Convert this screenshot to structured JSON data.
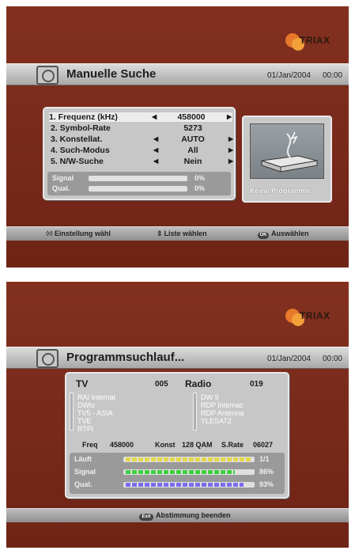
{
  "screen1": {
    "brand": "TRIAX",
    "title": "Manuelle Suche",
    "date": "01/Jan/2004",
    "time": "00:00",
    "fields": [
      {
        "label": "1. Frequenz (kHz)",
        "value": "458000",
        "arrows": true
      },
      {
        "label": "2. Symbol-Rate",
        "value": "5273",
        "arrows": false
      },
      {
        "label": "3. Konstellat.",
        "value": "AUTO",
        "arrows": true
      },
      {
        "label": "4. Such-Modus",
        "value": "All",
        "arrows": true
      },
      {
        "label": "5. N/W-Suche",
        "value": "Nein",
        "arrows": true
      }
    ],
    "signal_label": "Signal",
    "signal_pct": "0%",
    "quality_label": "Qual.",
    "quality_pct": "0%",
    "preview_caption": "Keine Programme",
    "hints": {
      "setting": "Einstellung wähl",
      "list": "Liste wählen",
      "ok_icon": "OK",
      "select": "Auswählen"
    }
  },
  "screen2": {
    "brand": "TRIAX",
    "title": "Programmsuchlauf...",
    "date": "01/Jan/2004",
    "time": "00:00",
    "tv_label": "TV",
    "tv_count": "005",
    "radio_label": "Radio",
    "radio_count": "019",
    "tv_channels": [
      "RAI Internat",
      "DWtv",
      "TV5 - ASIA",
      "TVE",
      "RTPi"
    ],
    "radio_channels": [
      "DW 9",
      "RDP Internac",
      "RDP Antenna",
      "YLESAT2"
    ],
    "freq_label": "Freq",
    "freq_value": "458000",
    "konst_label": "Konst",
    "konst_value": "128 QAM",
    "srate_label": "S.Rate",
    "srate_value": "06027",
    "progress_label": "Läuft",
    "progress_value": "1/1",
    "signal_label": "Signal",
    "signal_pct": "86%",
    "quality_label": "Qual.",
    "quality_pct": "93%",
    "meters": {
      "progress": 1.0,
      "signal": 0.86,
      "quality": 0.93
    },
    "colors": {
      "progress": "#e6d84a",
      "signal": "#3fd03f",
      "quality": "#7b6cf0"
    },
    "exit_icon": "Exit",
    "exit_hint": "Abstimmung beenden"
  }
}
